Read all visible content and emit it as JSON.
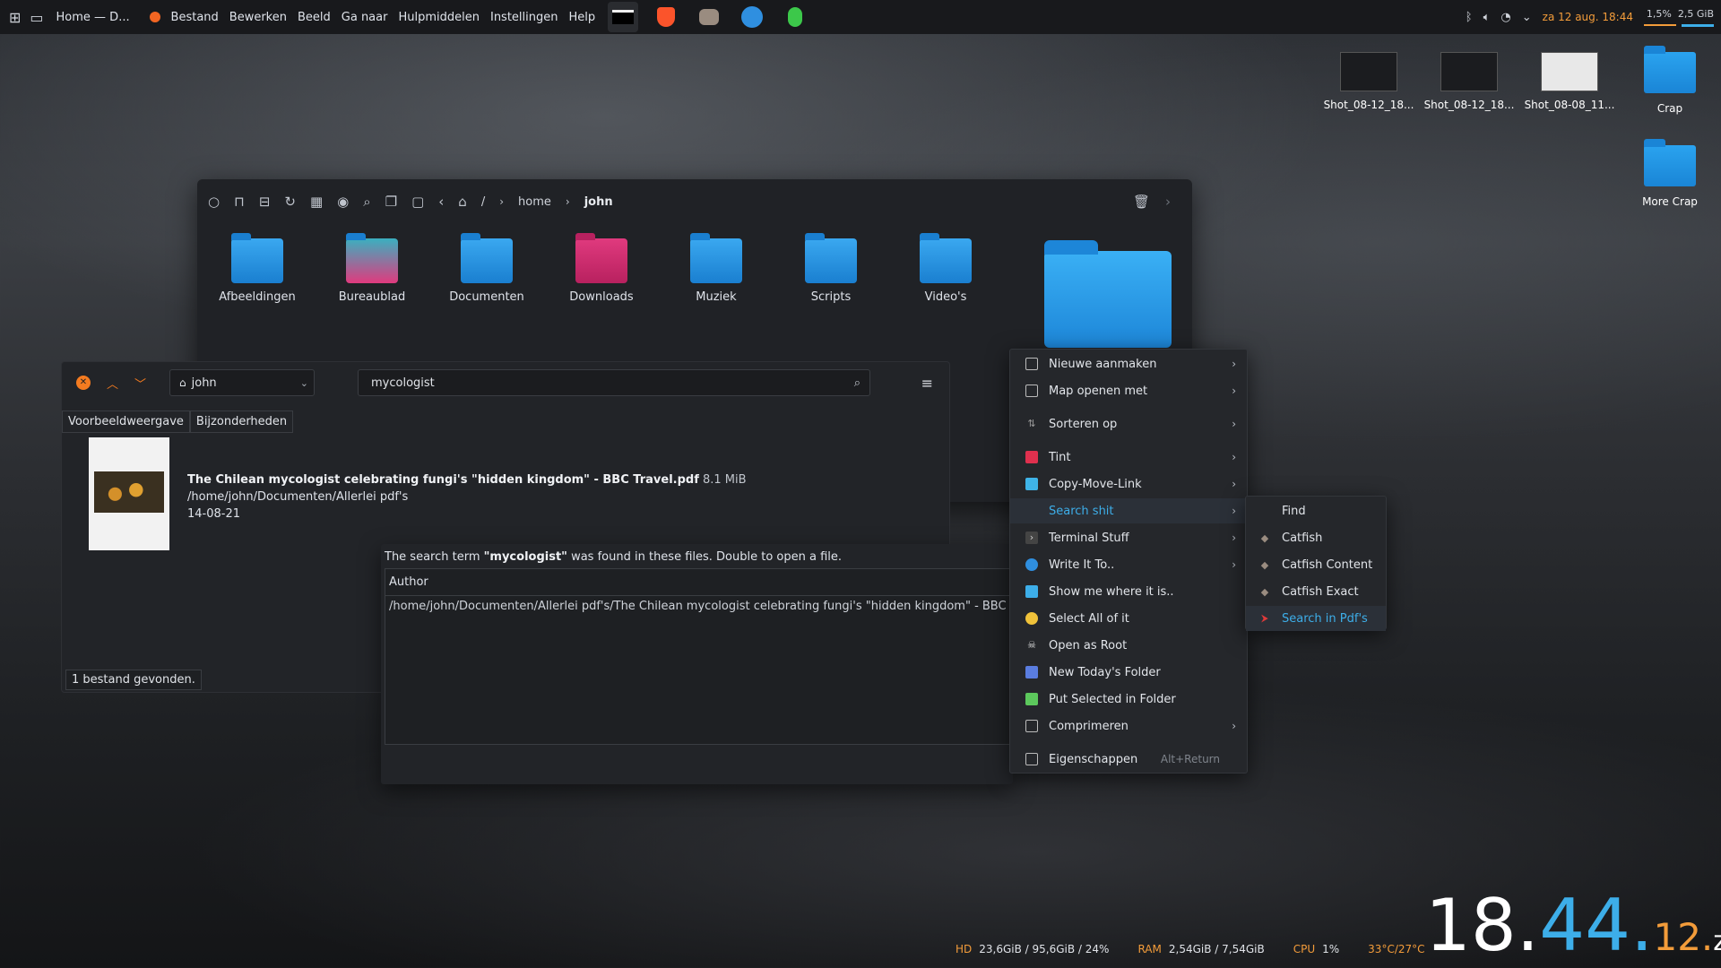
{
  "topbar": {
    "window_title": "Home — D...",
    "menu": [
      "Bestand",
      "Bewerken",
      "Beeld",
      "Ga naar",
      "Hulpmiddelen",
      "Instellingen",
      "Help"
    ],
    "clock": "za 12 aug. 18:44",
    "sysmon_cpu": "1,5%",
    "sysmon_mem": "2,5 GiB"
  },
  "desktop": {
    "icons": [
      "Shot_08-12_18...",
      "Shot_08-12_18...",
      "Shot_08-08_11...",
      "Crap",
      "More Crap"
    ]
  },
  "file_manager": {
    "breadcrumb": [
      "/",
      "home",
      "john"
    ],
    "folders": [
      "Afbeeldingen",
      "Bureaublad",
      "Documenten",
      "Downloads",
      "Muziek",
      "Scripts",
      "Video's"
    ]
  },
  "catfish": {
    "location": "john",
    "query": "mycologist",
    "tabs": [
      "Voorbeeldweergave",
      "Bijzonderheden"
    ],
    "result": {
      "title": "The Chilean mycologist celebrating fungi's \"hidden kingdom\" - BBC Travel.pdf",
      "size": "8.1 MiB",
      "path": "/home/john/Documenten/Allerlei pdf's",
      "date": "14-08-21"
    },
    "status": "1 bestand gevonden."
  },
  "dialog": {
    "msg_before": "The search term ",
    "msg_term": "\"mycologist\"",
    "msg_after": " was found in these files. Double to open a file.",
    "column": "Author",
    "row": "/home/john/Documenten/Allerlei pdf's/The Chilean mycologist celebrating fungi's \"hidden kingdom\" - BBC Travel."
  },
  "context_menu": {
    "items": [
      {
        "label": "Nieuwe aanmaken",
        "sub": true
      },
      {
        "label": "Map openen met",
        "sub": true
      },
      {
        "label": "Sorteren op",
        "sub": true
      },
      {
        "label": "Tint",
        "sub": true
      },
      {
        "label": "Copy-Move-Link",
        "sub": true
      },
      {
        "label": "Search shit",
        "sub": true
      },
      {
        "label": "Terminal Stuff",
        "sub": true
      },
      {
        "label": "Write It To..",
        "sub": true
      },
      {
        "label": "Show me where it is..",
        "sub": false
      },
      {
        "label": "Select All of it",
        "sub": false
      },
      {
        "label": "Open as Root",
        "sub": false
      },
      {
        "label": "New Today's Folder",
        "sub": false
      },
      {
        "label": "Put Selected in Folder",
        "sub": false
      },
      {
        "label": "Comprimeren",
        "sub": true
      },
      {
        "label": "Eigenschappen",
        "sub": false,
        "shortcut": "Alt+Return"
      }
    ],
    "submenu": [
      "Find",
      "Catfish",
      "Catfish Content",
      "Catfish Exact",
      "Search in Pdf's"
    ]
  },
  "status_bar": {
    "hd_label": "HD",
    "hd_value": "23,6GiB / 95,6GiB / 24%",
    "ram_label": "RAM",
    "ram_value": "2,54GiB / 7,54GiB",
    "cpu_label": "CPU",
    "cpu_value": "1%",
    "temp": "33°C/27°C"
  },
  "big_clock": {
    "hour": "18.",
    "minute": "44.",
    "second": "12.",
    "day": "za"
  },
  "colors": {
    "accent": "#3daee9",
    "orange": "#f39c3a",
    "folder_blue": "#1a85d6"
  }
}
